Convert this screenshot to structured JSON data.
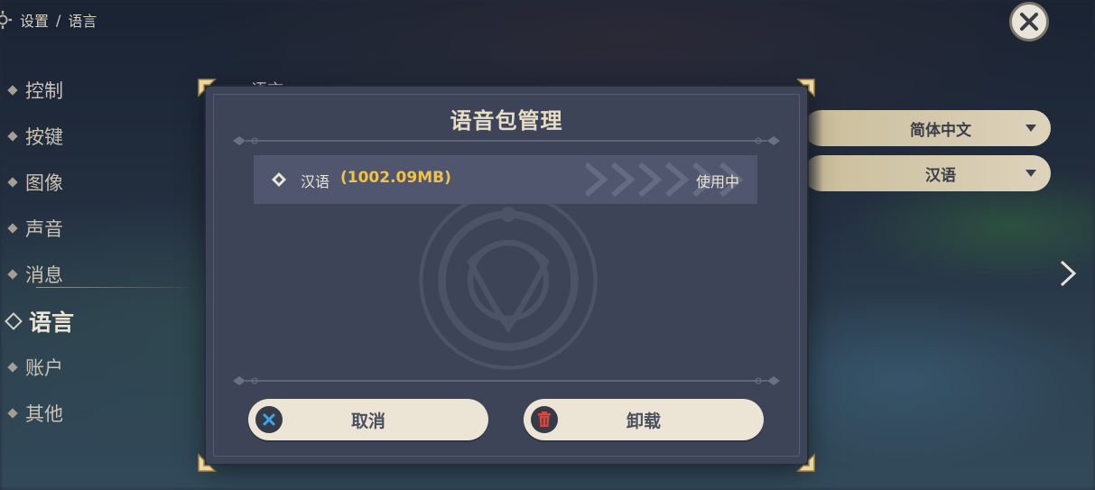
{
  "breadcrumb": {
    "root": "设置",
    "separator": "/",
    "current": "语言"
  },
  "side_nav": [
    {
      "label": "控制",
      "active": false
    },
    {
      "label": "按键",
      "active": false
    },
    {
      "label": "图像",
      "active": false
    },
    {
      "label": "声音",
      "active": false
    },
    {
      "label": "消息",
      "active": false
    },
    {
      "label": "语言",
      "active": true
    },
    {
      "label": "账户",
      "active": false
    },
    {
      "label": "其他",
      "active": false
    }
  ],
  "settings": {
    "section_label": "语言",
    "text_language": "简体中文",
    "voice_language": "汉语"
  },
  "modal": {
    "title": "语音包管理",
    "packs": [
      {
        "name": "汉语",
        "size": "(1002.09MB)",
        "status": "使用中"
      }
    ],
    "cancel_label": "取消",
    "uninstall_label": "卸载"
  },
  "colors": {
    "panel": "#3e4457",
    "row": "#4f566d",
    "accent_gold": "#f0c24b",
    "button_bg": "#ece5d6",
    "cancel_icon": "#3aa7e6",
    "uninstall_icon": "#e0453a"
  }
}
